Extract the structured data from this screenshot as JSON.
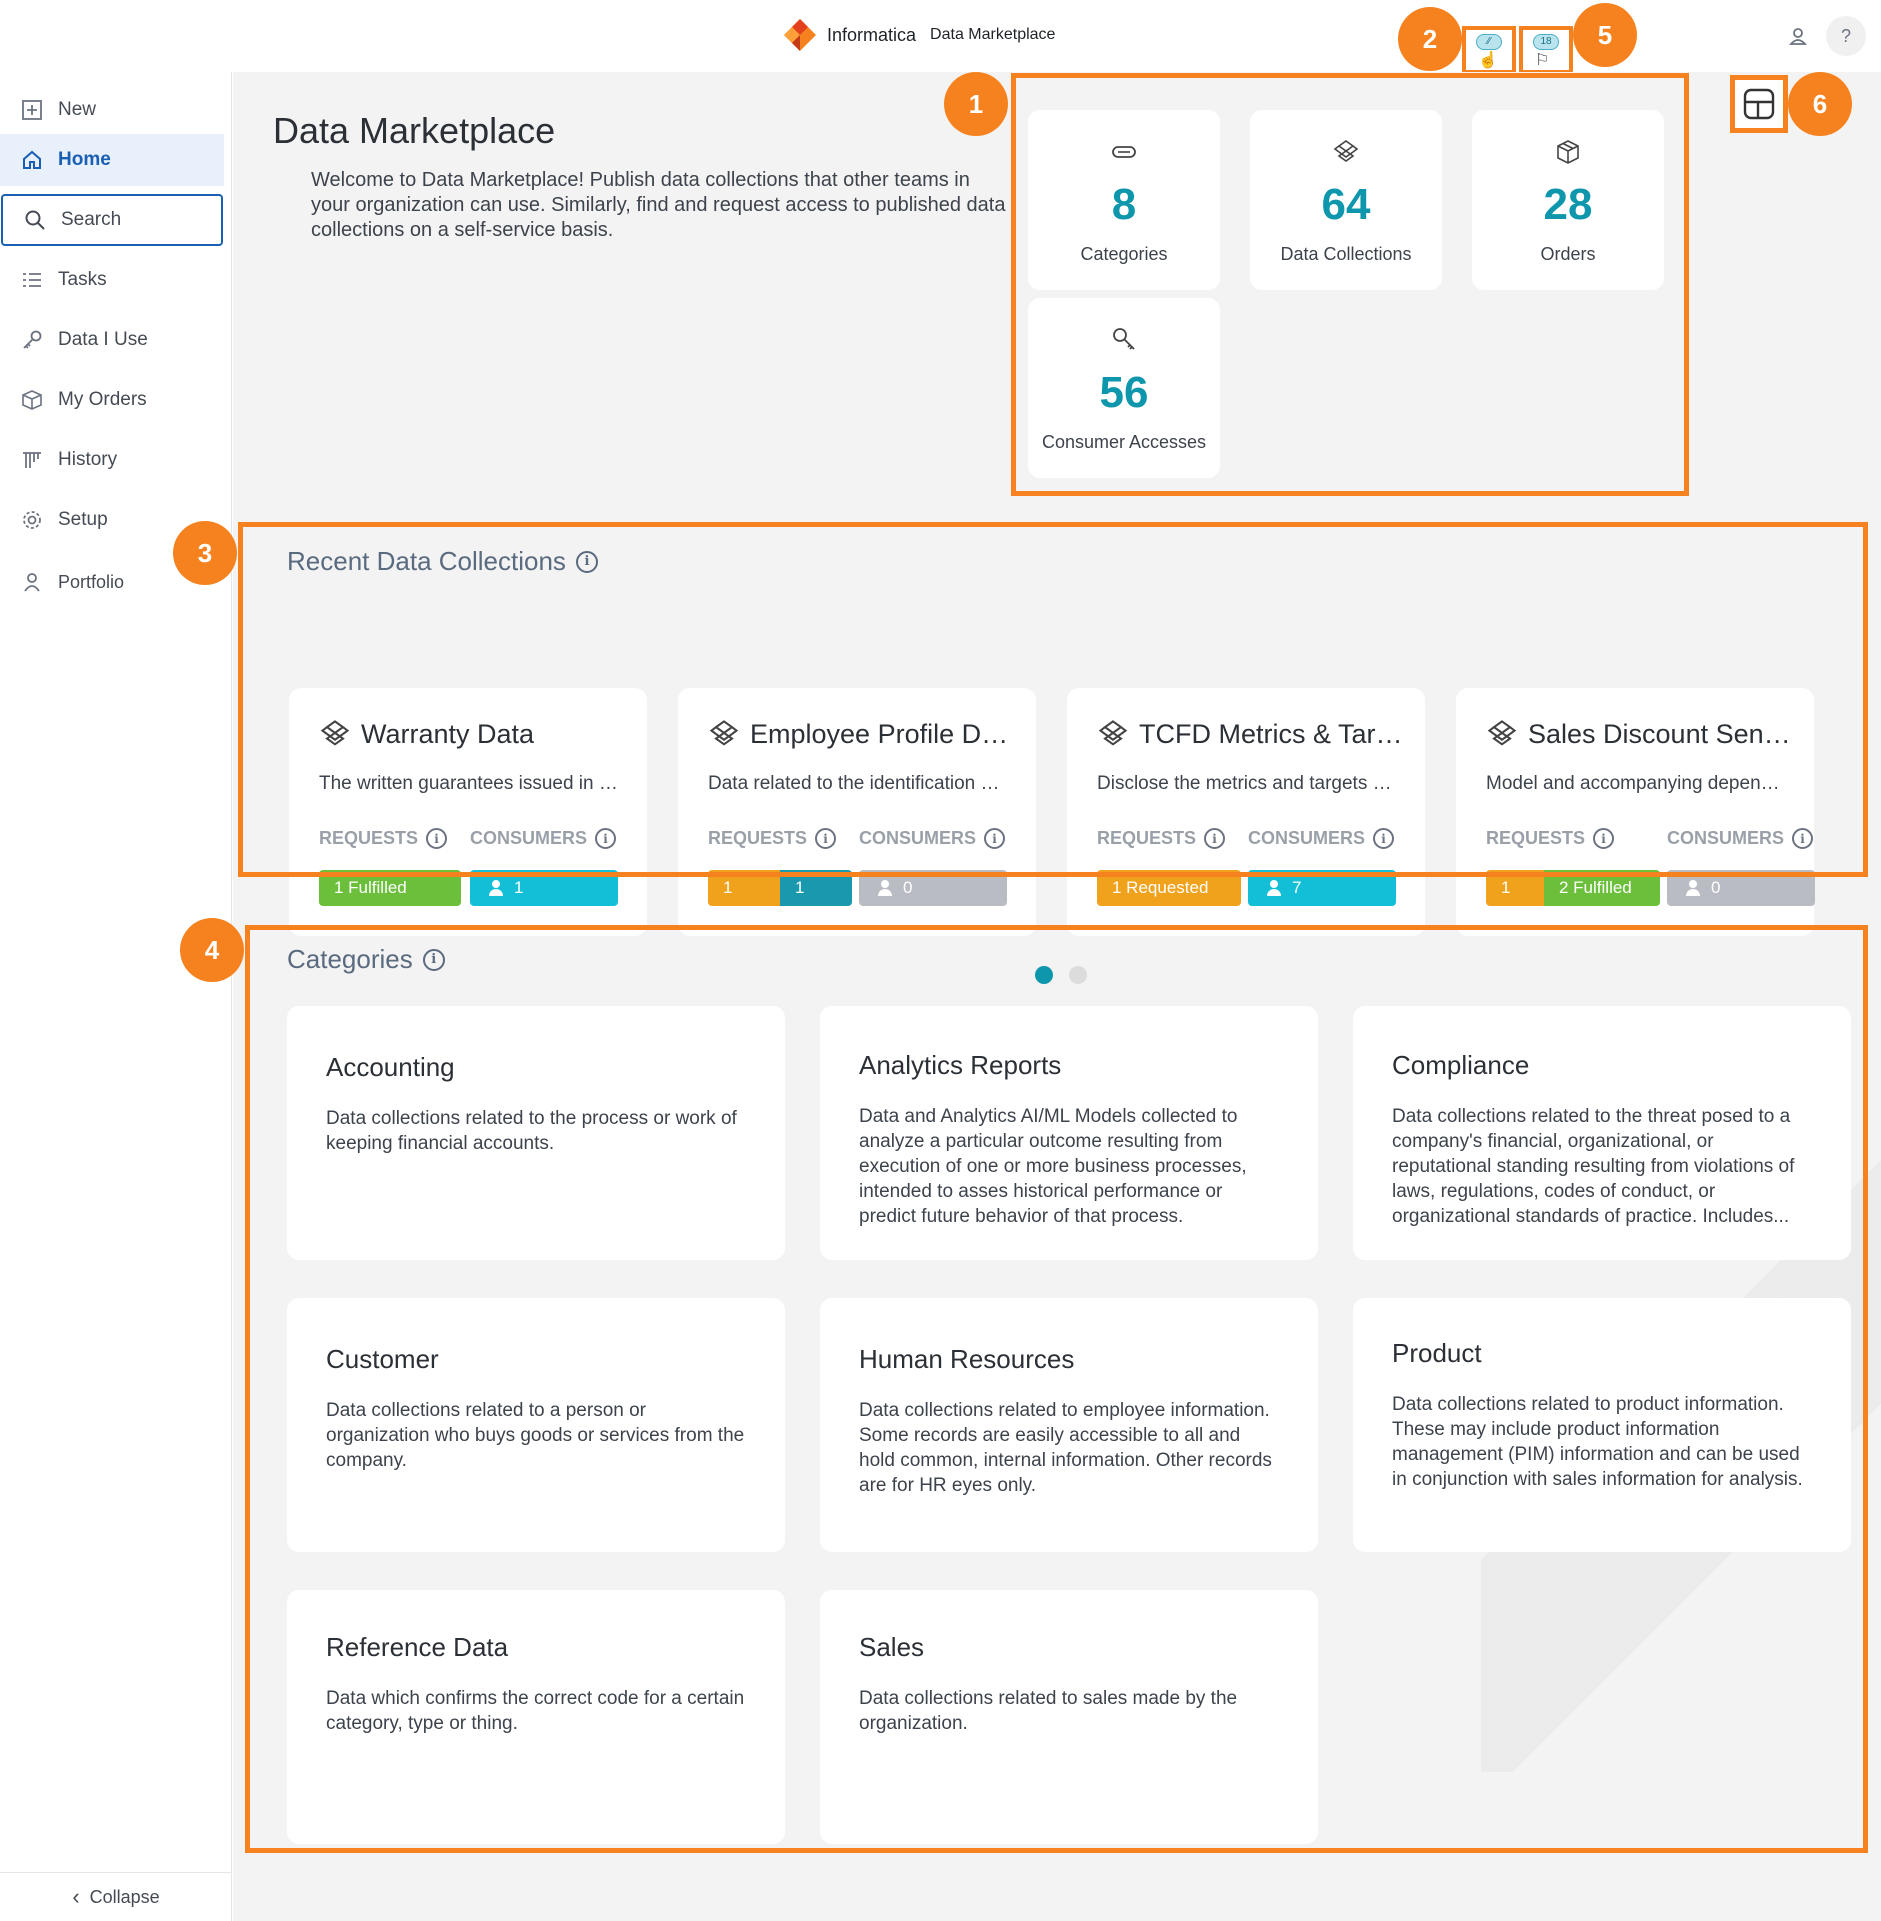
{
  "header": {
    "brand": "Informatica",
    "app_name": "Data Marketplace",
    "notification_count": "",
    "flag_count": "18"
  },
  "sidebar": {
    "items": [
      {
        "label": "New",
        "icon": "plus-square-icon"
      },
      {
        "label": "Home",
        "icon": "home-icon"
      },
      {
        "label": "Search",
        "icon": "search-icon"
      },
      {
        "label": "Tasks",
        "icon": "tasks-icon"
      },
      {
        "label": "Data I Use",
        "icon": "key-icon"
      },
      {
        "label": "My Orders",
        "icon": "box-icon"
      },
      {
        "label": "History",
        "icon": "history-icon"
      },
      {
        "label": "Setup",
        "icon": "gear-icon"
      },
      {
        "label": "Portfolio",
        "icon": "user-icon"
      }
    ],
    "collapse_label": "Collapse"
  },
  "main": {
    "title": "Data Marketplace",
    "welcome": "Welcome to Data Marketplace! Publish data collections that other teams in your organization can use. Similarly, find and request access to published data collections on a self-service basis.",
    "stats": [
      {
        "value": "8",
        "label": "Categories"
      },
      {
        "value": "64",
        "label": "Data Collections"
      },
      {
        "value": "28",
        "label": "Orders"
      },
      {
        "value": "56",
        "label": "Consumer Accesses"
      }
    ],
    "recent_title": "Recent Data Collections",
    "requests_label": "REQUESTS",
    "consumers_label": "CONSUMERS",
    "collections": [
      {
        "name": "Warranty Data",
        "desc": "The written guarantees issued in the warranty process",
        "req1": "1 Fulfilled",
        "req2": "",
        "cons": "1"
      },
      {
        "name": "Employee Profile Data",
        "desc": "Data related to the identification of employees",
        "req1": "1",
        "req2": "1",
        "cons": "0"
      },
      {
        "name": "TCFD Metrics & Targets",
        "desc": "Disclose the metrics and targets used to assess",
        "req1": "1 Requested",
        "req2": "",
        "cons": "7"
      },
      {
        "name": "Sales Discount Sensitivity",
        "desc": "Model and accompanying dependencies for sales",
        "req1": "1",
        "req2": "2 Fulfilled",
        "cons": "0"
      }
    ],
    "categories_title": "Categories",
    "categories": [
      {
        "title": "Accounting",
        "desc": "Data collections related to the process or work of keeping financial accounts."
      },
      {
        "title": "Analytics Reports",
        "desc": "Data and Analytics AI/ML Models collected to analyze a particular outcome resulting from execution of one or more business processes, intended to asses historical performance or predict future behavior of that process."
      },
      {
        "title": "Compliance",
        "desc": "Data collections related to the threat posed to a company's financial, organizational, or reputational standing resulting from violations of laws, regulations, codes of conduct, or organizational standards of practice. Includes..."
      },
      {
        "title": "Customer",
        "desc": "Data collections related to a person or organization who buys goods or services from the company."
      },
      {
        "title": "Human Resources",
        "desc": "Data collections related to employee information. Some records are easily accessible to all and hold common, internal information. Other records are for HR eyes only."
      },
      {
        "title": "Product",
        "desc": "Data collections related to product information. These may include product information management (PIM) information and can be used in conjunction with sales information for analysis."
      },
      {
        "title": "Reference Data",
        "desc": "Data which confirms the correct code for a certain category, type or thing."
      },
      {
        "title": "Sales",
        "desc": "Data collections related to sales made by the organization."
      }
    ]
  },
  "callouts": [
    "1",
    "2",
    "3",
    "4",
    "5",
    "6"
  ],
  "colors": {
    "accent": "#0e96ad",
    "callout": "#f5821f",
    "fulfilled": "#6bbf3a",
    "requested": "#f0a21c",
    "consumers": "#12bfd6",
    "empty": "#b9bcc2"
  }
}
